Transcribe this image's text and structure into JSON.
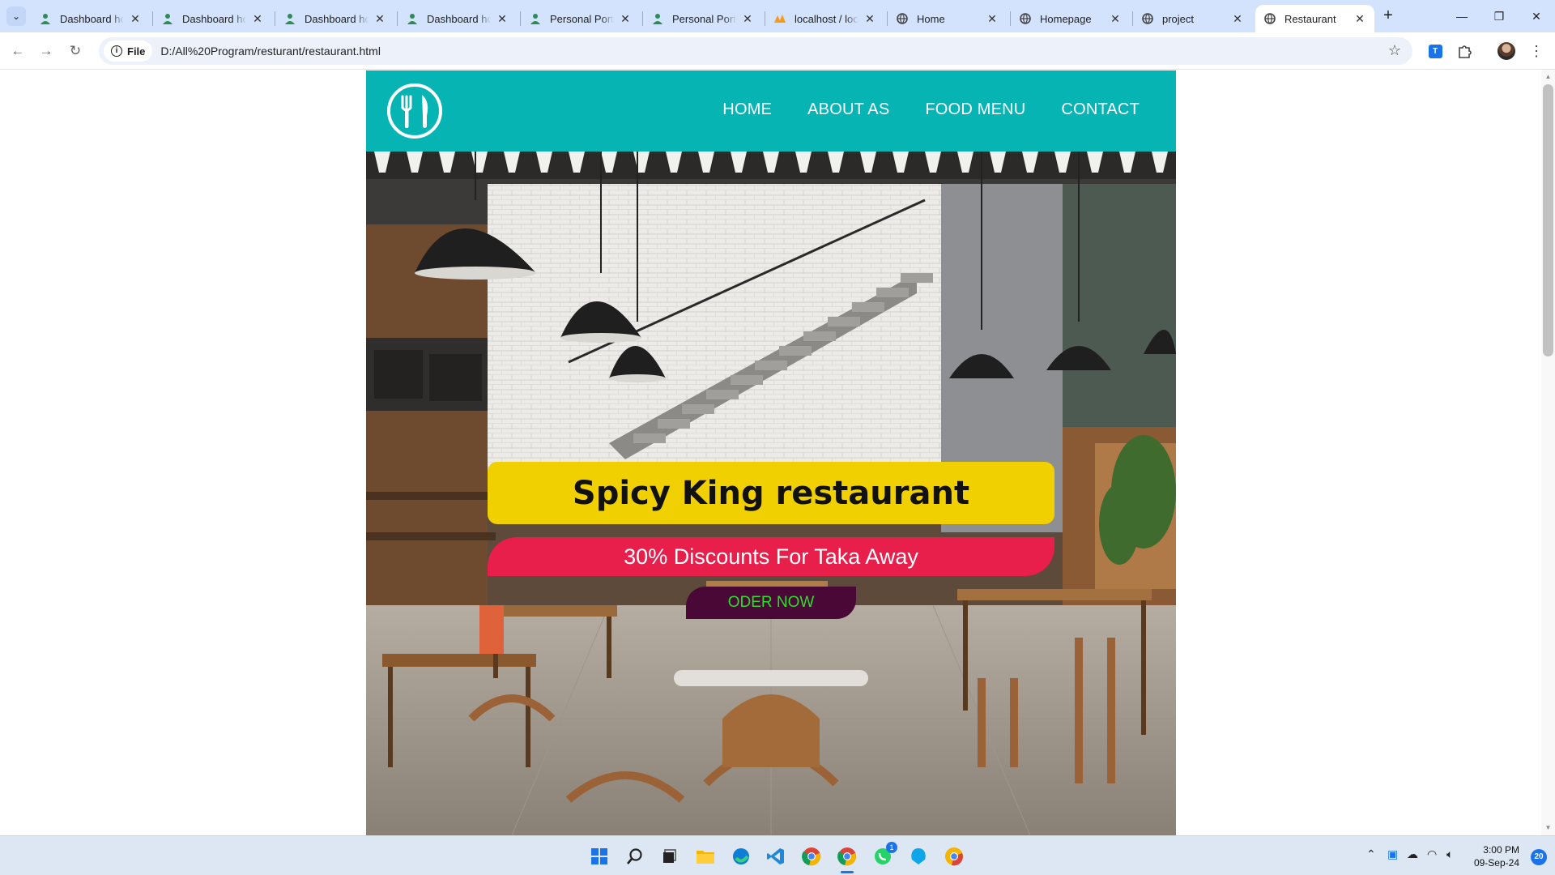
{
  "browser": {
    "tabs": [
      {
        "title": "Dashboard hom",
        "icon": "person-icon"
      },
      {
        "title": "Dashboard hom",
        "icon": "person-icon"
      },
      {
        "title": "Dashboard hom",
        "icon": "person-icon"
      },
      {
        "title": "Dashboard hom",
        "icon": "person-icon"
      },
      {
        "title": "Personal Portfo",
        "icon": "person-icon"
      },
      {
        "title": "Personal Portfo",
        "icon": "person-icon"
      },
      {
        "title": "localhost / loca",
        "icon": "phpmyadmin-icon"
      },
      {
        "title": "Home",
        "icon": "globe-icon"
      },
      {
        "title": "Homepage",
        "icon": "globe-icon"
      },
      {
        "title": "project",
        "icon": "globe-icon"
      },
      {
        "title": "Restaurant",
        "icon": "globe-icon",
        "active": true
      }
    ],
    "address": {
      "chip_label": "File",
      "url": "D:/All%20Program/resturant/restaurant.html"
    }
  },
  "site": {
    "brand_color": "#06b4b4",
    "nav": [
      "HOME",
      "ABOUT AS",
      "FOOD MENU",
      "CONTACT"
    ],
    "hero": {
      "title": "Spicy King restaurant",
      "discount": "30% Discounts For Taka Away",
      "cta": "ODER NOW"
    },
    "colors": {
      "title_bg": "#f0d000",
      "discount_bg": "#e81e4b",
      "cta_bg": "#4a0836",
      "cta_text": "#28e028"
    }
  },
  "taskbar": {
    "apps": [
      "windows-start-icon",
      "search-icon",
      "task-view-icon",
      "file-explorer-icon",
      "edge-icon",
      "vscode-icon",
      "chrome-icon",
      "chrome-active-icon",
      "whatsapp-icon",
      "app-icon",
      "chrome-canary-icon"
    ],
    "whatsapp_badge": "1",
    "time": "3:00 PM",
    "date": "09-Sep-24",
    "notifications": "20"
  }
}
